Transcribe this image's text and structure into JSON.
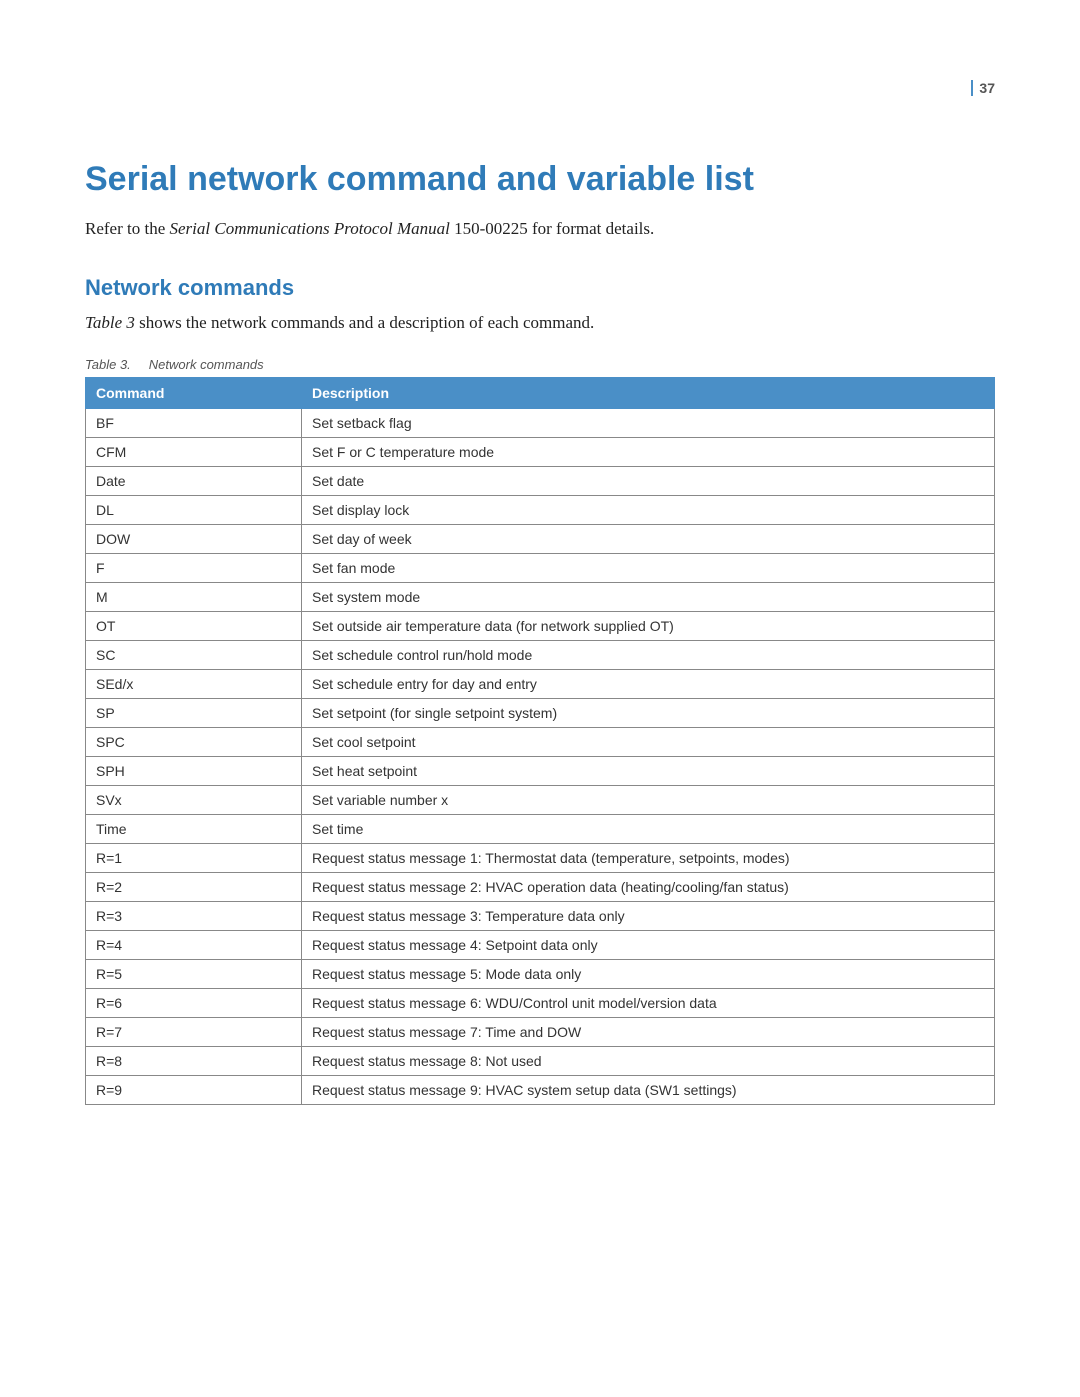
{
  "page_number": "37",
  "h1": "Serial network command and variable list",
  "intro_prefix": "Refer to the ",
  "intro_italic": "Serial Communications Protocol Manual",
  "intro_suffix": " 150-00225 for format details.",
  "h2": "Network commands",
  "body_prefix": "",
  "body_italic": "Table 3",
  "body_suffix": " shows the network commands and a description of each command.",
  "table_caption_label": "Table 3.",
  "table_caption_title": "Network commands",
  "table": {
    "headers": [
      "Command",
      "Description"
    ],
    "rows": [
      {
        "cmd": "BF",
        "desc": "Set setback flag"
      },
      {
        "cmd": "CFM",
        "desc": "Set F or C temperature mode"
      },
      {
        "cmd": "Date",
        "desc": "Set date"
      },
      {
        "cmd": "DL",
        "desc": "Set display lock"
      },
      {
        "cmd": "DOW",
        "desc": "Set day of week"
      },
      {
        "cmd": "F",
        "desc": "Set fan mode"
      },
      {
        "cmd": "M",
        "desc": "Set system mode"
      },
      {
        "cmd": "OT",
        "desc": "Set outside air temperature data (for network supplied OT)"
      },
      {
        "cmd": "SC",
        "desc": "Set schedule control run/hold mode"
      },
      {
        "cmd": "SEd/x",
        "desc": "Set schedule entry for day and entry"
      },
      {
        "cmd": "SP",
        "desc": "Set setpoint (for single setpoint system)"
      },
      {
        "cmd": "SPC",
        "desc": "Set cool setpoint"
      },
      {
        "cmd": "SPH",
        "desc": "Set heat setpoint"
      },
      {
        "cmd": "SVx",
        "desc": "Set variable number x"
      },
      {
        "cmd": "Time",
        "desc": "Set time"
      },
      {
        "cmd": "R=1",
        "desc": "Request status message 1: Thermostat data (temperature, setpoints, modes)"
      },
      {
        "cmd": "R=2",
        "desc": "Request status message 2: HVAC operation data (heating/cooling/fan status)"
      },
      {
        "cmd": "R=3",
        "desc": "Request status message 3:  Temperature data only"
      },
      {
        "cmd": "R=4",
        "desc": "Request status message 4:  Setpoint data only"
      },
      {
        "cmd": "R=5",
        "desc": "Request status message 5:  Mode data only"
      },
      {
        "cmd": "R=6",
        "desc": "Request status message 6: WDU/Control unit model/version data"
      },
      {
        "cmd": "R=7",
        "desc": "Request status message 7:  Time and DOW"
      },
      {
        "cmd": "R=8",
        "desc": "Request status message 8: Not used"
      },
      {
        "cmd": "R=9",
        "desc": "Request status message 9: HVAC system setup data (SW1 settings)"
      }
    ]
  }
}
